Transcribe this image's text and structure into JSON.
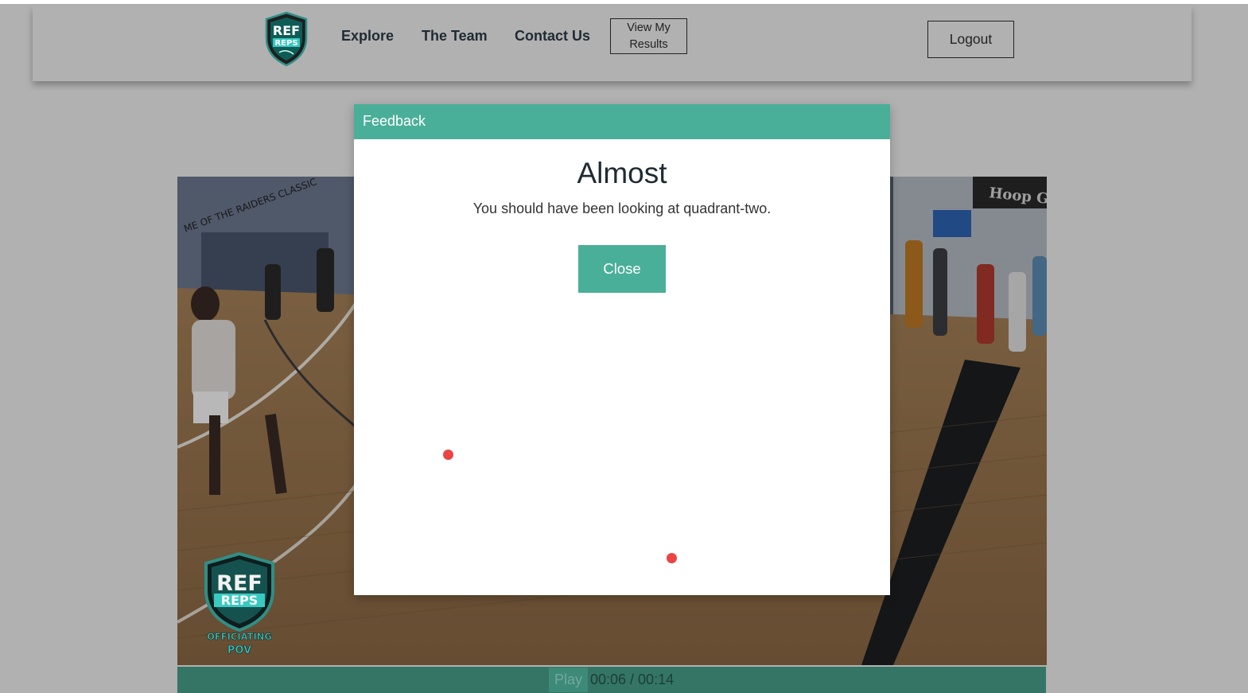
{
  "nav": {
    "logo_alt": "REF REPS",
    "links": [
      "Explore",
      "The Team",
      "Contact Us"
    ],
    "results_button": [
      "View My",
      "Results"
    ],
    "logout_label": "Logout"
  },
  "video": {
    "watermark_text": [
      "REF",
      "REPS",
      "OFFICIATING",
      "POV"
    ],
    "play_label": "Play",
    "time": "00:06 / 00:14"
  },
  "modal": {
    "header": "Feedback",
    "title": "Almost",
    "message": "You should have been looking at quadrant-two.",
    "close_label": "Close"
  },
  "colors": {
    "accent": "#4aaf98",
    "controls_bar": "#347566",
    "marker": "#ec4343",
    "page_bg": "#b1b1b1"
  },
  "icons": [
    "ref-reps-shield-logo",
    "ref-reps-watermark-logo",
    "click-marker-dot"
  ]
}
